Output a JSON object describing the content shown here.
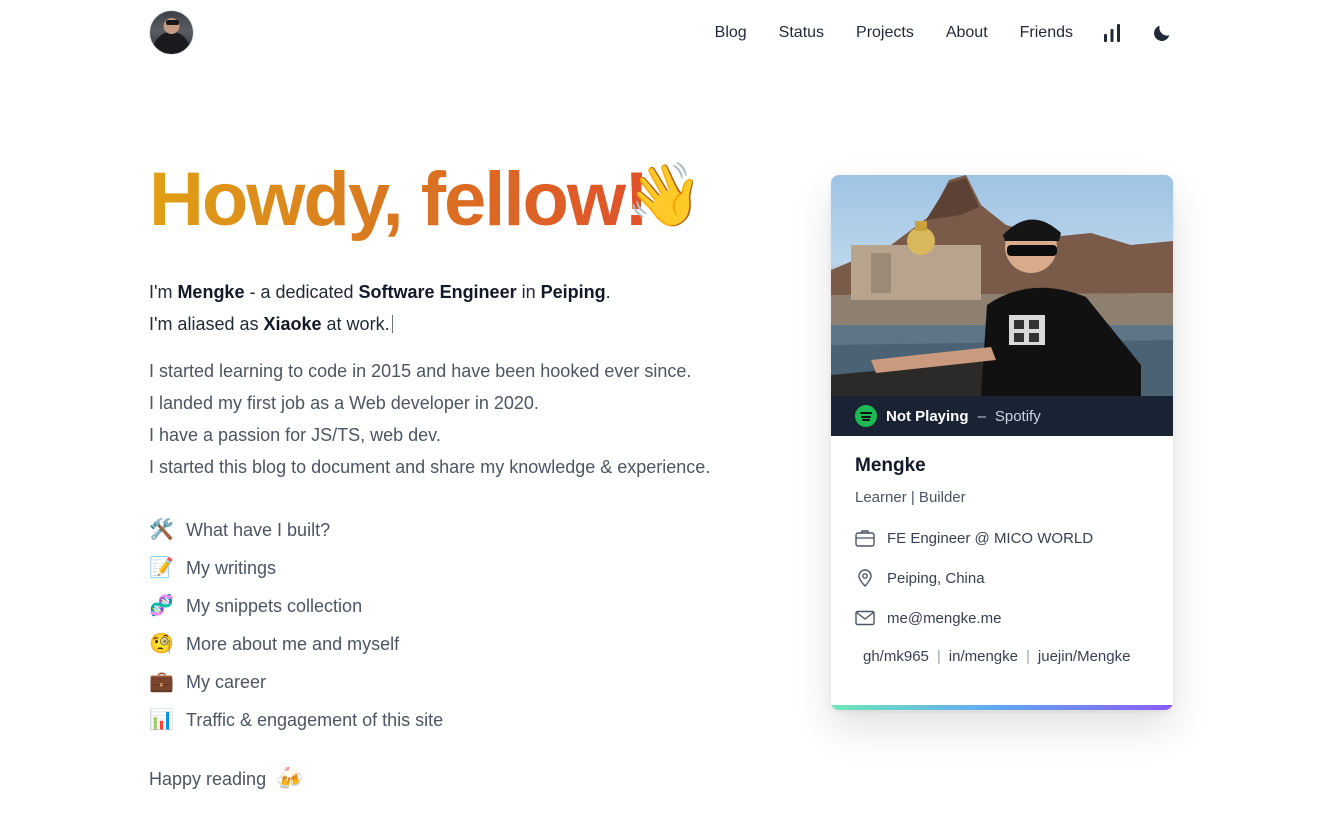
{
  "nav": {
    "items": [
      {
        "label": "Blog"
      },
      {
        "label": "Status"
      },
      {
        "label": "Projects"
      },
      {
        "label": "About"
      },
      {
        "label": "Friends"
      }
    ],
    "icons": [
      "bar-chart-icon",
      "moon-icon"
    ]
  },
  "hero": {
    "title": "Howdy, fellow!",
    "emoji": "👋"
  },
  "intro": {
    "line1_a": "I'm ",
    "name": "Mengke",
    "line1_b": " - a dedicated ",
    "role": "Software Engineer",
    "line1_c": " in ",
    "city": "Peiping",
    "line1_d": ".",
    "line2_a": "I'm aliased as ",
    "alias": "Xiaoke",
    "line2_b": " at work."
  },
  "about": [
    "I started learning to code in 2015 and have been hooked ever since.",
    "I landed my first job as a Web developer in 2020.",
    "I have a passion for JS/TS, web dev.",
    "I started this blog to document and share my knowledge & experience."
  ],
  "links": [
    {
      "emoji": "🛠️",
      "label": "What have I built?"
    },
    {
      "emoji": "📝",
      "label": "My writings"
    },
    {
      "emoji": "🧬",
      "label": "My snippets collection"
    },
    {
      "emoji": "🧐",
      "label": "More about me and myself"
    },
    {
      "emoji": "💼",
      "label": "My career"
    },
    {
      "emoji": "📊",
      "label": "Traffic & engagement of this site"
    }
  ],
  "footer": {
    "text": "Happy reading",
    "emoji": "🍻"
  },
  "card": {
    "spotify": {
      "status": "Not Playing",
      "separator": "–",
      "source": "Spotify"
    },
    "name": "Mengke",
    "role": "Learner | Builder",
    "job": "FE Engineer @ MICO WORLD",
    "location": "Peiping, China",
    "email": "me@mengke.me",
    "socials": [
      "gh/mk965",
      "in/mengke",
      "juejin/Mengke"
    ],
    "social_separator": "|"
  },
  "colors": {
    "title_gradient": [
      "#e0a015",
      "#e0512a"
    ],
    "spotify_bar": "#1a2333",
    "spotify_green": "#1db954",
    "card_bar_gradient": [
      "#6ee7b7",
      "#60a5fa",
      "#8b5cf6"
    ]
  }
}
